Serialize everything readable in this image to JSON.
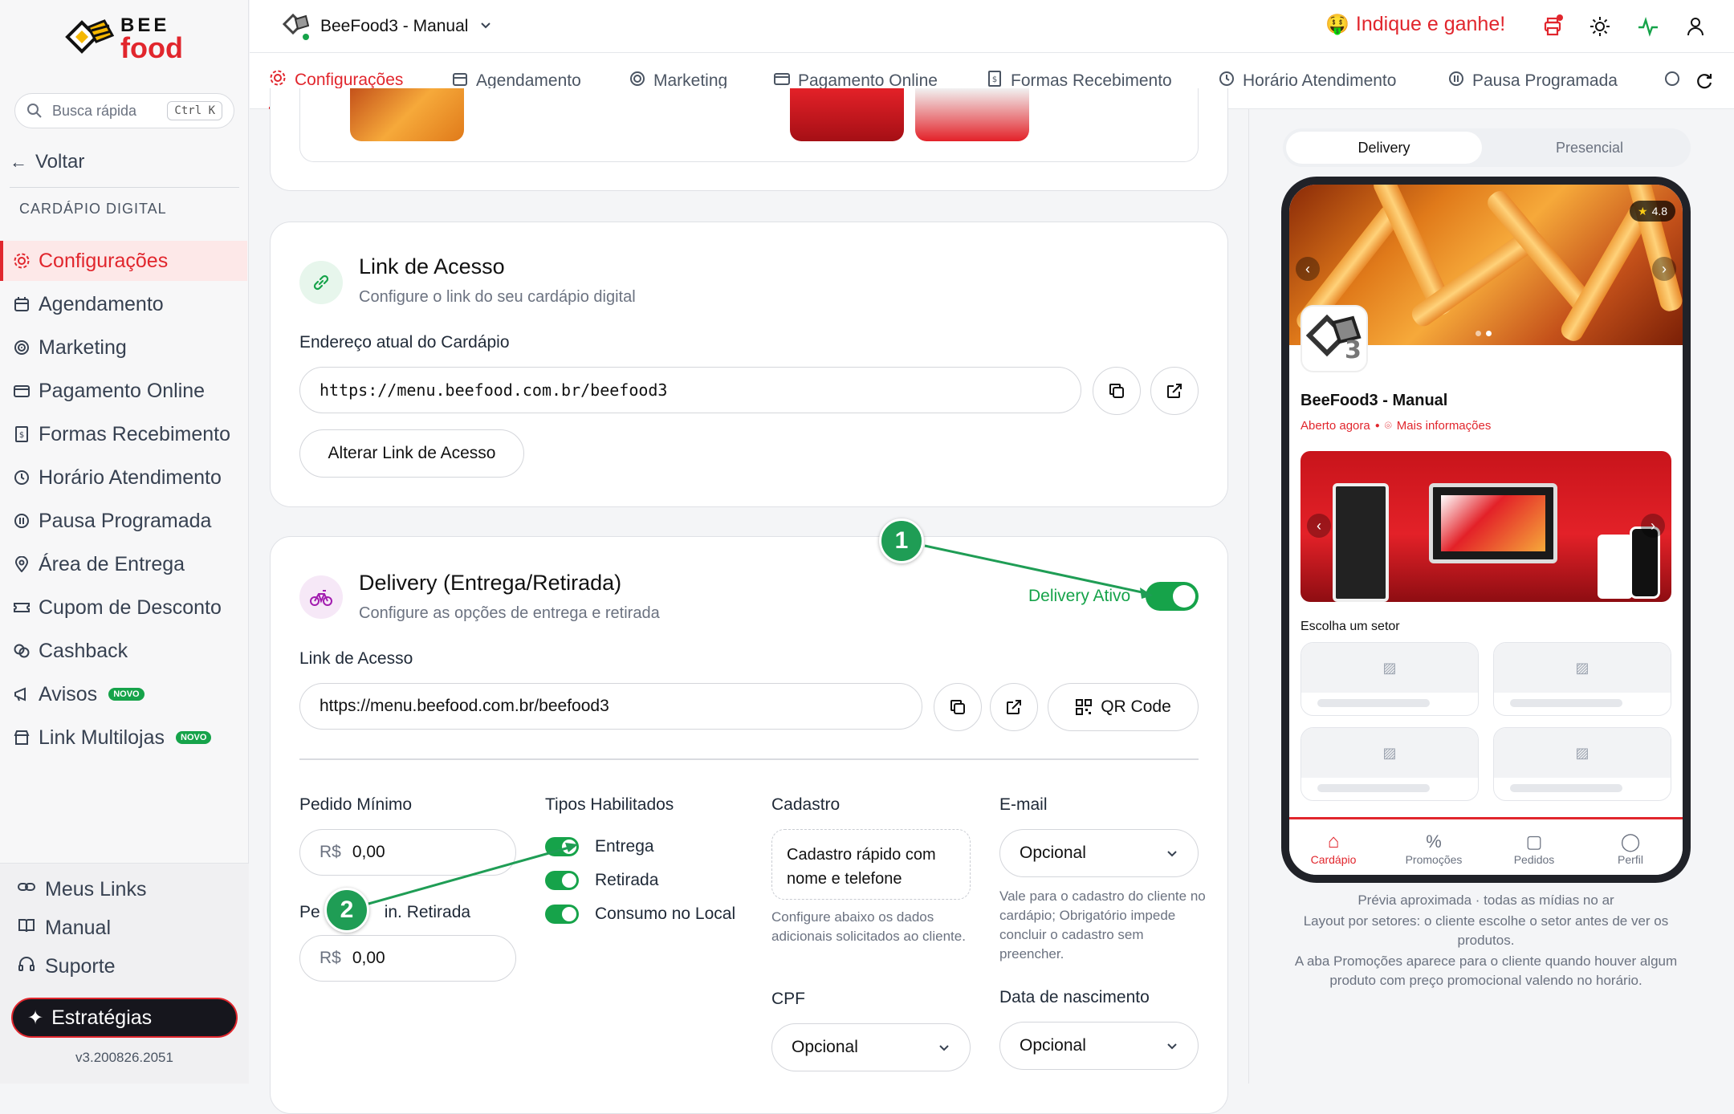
{
  "app": {
    "logo_top": "BEE",
    "logo_bottom": "food"
  },
  "sidebar": {
    "search_placeholder": "Busca rápida",
    "search_shortcut": "Ctrl K",
    "back_label": "Voltar",
    "section_label": "CARDÁPIO DIGITAL",
    "items": [
      {
        "label": "Configurações",
        "icon": "gear-icon",
        "active": true
      },
      {
        "label": "Agendamento",
        "icon": "calendar-icon"
      },
      {
        "label": "Marketing",
        "icon": "target-icon"
      },
      {
        "label": "Pagamento Online",
        "icon": "credit-card-icon"
      },
      {
        "label": "Formas Recebimento",
        "icon": "receipt-icon"
      },
      {
        "label": "Horário Atendimento",
        "icon": "clock-icon"
      },
      {
        "label": "Pausa Programada",
        "icon": "pause-icon"
      },
      {
        "label": "Área de Entrega",
        "icon": "map-pin-icon"
      },
      {
        "label": "Cupom de Desconto",
        "icon": "ticket-icon"
      },
      {
        "label": "Cashback",
        "icon": "coins-icon"
      },
      {
        "label": "Avisos",
        "icon": "megaphone-icon",
        "badge": "NOVO"
      },
      {
        "label": "Link Multilojas",
        "icon": "store-icon",
        "badge": "NOVO"
      }
    ],
    "bottom": [
      {
        "label": "Meus Links",
        "icon": "link-icon"
      },
      {
        "label": "Manual",
        "icon": "book-icon"
      },
      {
        "label": "Suporte",
        "icon": "headset-icon"
      }
    ],
    "strategies_label": "Estratégias",
    "version": "v3.200826.2051"
  },
  "topbar": {
    "store_name": "BeeFood3 - Manual",
    "referral": "Indique e ganhe!",
    "referral_emoji": "🤑"
  },
  "tabs": [
    {
      "label": "Configurações",
      "active": true
    },
    {
      "label": "Agendamento"
    },
    {
      "label": "Marketing"
    },
    {
      "label": "Pagamento Online"
    },
    {
      "label": "Formas Recebimento"
    },
    {
      "label": "Horário Atendimento"
    },
    {
      "label": "Pausa Programada"
    }
  ],
  "link_card": {
    "title": "Link de Acesso",
    "subtitle": "Configure o link do seu cardápio digital",
    "address_label": "Endereço atual do Cardápio",
    "address_value": "https://menu.beefood.com.br/beefood3",
    "change_button": "Alterar Link de Acesso"
  },
  "delivery_card": {
    "title": "Delivery (Entrega/Retirada)",
    "subtitle": "Configure as opções de entrega e retirada",
    "toggle_label": "Delivery Ativo",
    "toggle_on": true,
    "link_label": "Link de Acesso",
    "link_value": "https://menu.beefood.com.br/beefood3",
    "qr_button": "QR Code",
    "min_order_label": "Pedido Mínimo",
    "min_order_currency": "R$",
    "min_order_value": "0,00",
    "min_pickup_label": "Pedido Mín. Retirada",
    "min_pickup_label_visible_a": "Pe",
    "min_pickup_label_visible_b": "in. Retirada",
    "min_pickup_currency": "R$",
    "min_pickup_value": "0,00",
    "types_label": "Tipos Habilitados",
    "types": [
      {
        "label": "Entrega",
        "on": true
      },
      {
        "label": "Retirada",
        "on": true
      },
      {
        "label": "Consumo no Local",
        "on": true
      }
    ],
    "register_label": "Cadastro",
    "register_value": "Cadastro rápido com nome e telefone",
    "register_help": "Configure abaixo os dados adicionais solicitados ao cliente.",
    "email_label": "E-mail",
    "email_value": "Opcional",
    "email_help": "Vale para o cadastro do cliente no cardápio; Obrigatório impede concluir o cadastro sem preencher.",
    "cpf_label": "CPF",
    "cpf_value": "Opcional",
    "birth_label": "Data de nascimento",
    "birth_value": "Opcional"
  },
  "preview": {
    "seg_delivery": "Delivery",
    "seg_presencial": "Presencial",
    "rating": "4.8",
    "store_name": "BeeFood3 - Manual",
    "open_status": "Aberto agora",
    "more_info": "Mais informações",
    "choose_sector": "Escolha um setor",
    "nav": [
      "Cardápio",
      "Promoções",
      "Pedidos",
      "Perfil"
    ],
    "note_1": "Prévia aproximada · todas as mídias no ar",
    "note_2": "Layout por setores: o cliente escolhe o setor antes de ver os produtos.",
    "note_3": "A aba Promoções aparece para o cliente quando houver algum produto com preço promocional valendo no horário."
  },
  "annotations": {
    "marker_1": "1",
    "marker_2": "2",
    "color": "#1f9d55"
  },
  "colors": {
    "accent": "#e1262d",
    "toggle_on": "#16a34a"
  }
}
